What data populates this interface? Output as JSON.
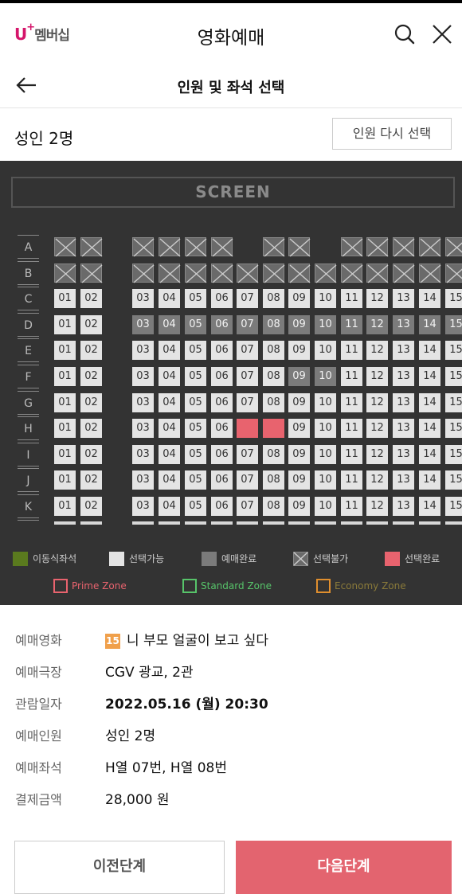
{
  "header": {
    "logo_u": "U",
    "logo_plus": "+",
    "logo_text": "멤버십",
    "title": "영화예매",
    "search_icon": "search-icon",
    "close_icon": "close-icon"
  },
  "subheader": {
    "back_icon": "arrow-left-icon",
    "title": "인원 및 좌석 선택"
  },
  "people": {
    "label": "성인 2명",
    "reselect_label": "인원 다시 선택"
  },
  "seatmap": {
    "screen_label": "SCREEN",
    "rows": [
      {
        "label": "A",
        "seats": [
          "x",
          "x",
          "_",
          "x",
          "x",
          "x",
          "x",
          "_",
          "x",
          "x",
          "_",
          "x",
          "x",
          "x",
          "x",
          "x"
        ]
      },
      {
        "label": "B",
        "seats": [
          "x",
          "x",
          "_",
          "x",
          "x",
          "x",
          "x",
          "x",
          "x",
          "x",
          "x",
          "x",
          "x",
          "x",
          "x",
          "x"
        ]
      },
      {
        "label": "C",
        "seats": [
          "01",
          "02",
          "_",
          "03",
          "04",
          "05",
          "06",
          "07",
          "08",
          "09",
          "10",
          "11",
          "12",
          "13",
          "14",
          "15"
        ]
      },
      {
        "label": "D",
        "seats": [
          "01",
          "02",
          "_",
          "03",
          "04",
          "05",
          "06",
          "07",
          "08",
          "09",
          "10",
          "11",
          "12",
          "13",
          "14",
          "15"
        ],
        "done": [
          "03",
          "04",
          "05",
          "06",
          "07",
          "08",
          "09",
          "10",
          "11",
          "12",
          "13",
          "14",
          "15"
        ]
      },
      {
        "label": "E",
        "seats": [
          "01",
          "02",
          "_",
          "03",
          "04",
          "05",
          "06",
          "07",
          "08",
          "09",
          "10",
          "11",
          "12",
          "13",
          "14",
          "15"
        ]
      },
      {
        "label": "F",
        "seats": [
          "01",
          "02",
          "_",
          "03",
          "04",
          "05",
          "06",
          "07",
          "08",
          "09",
          "10",
          "11",
          "12",
          "13",
          "14",
          "15"
        ],
        "done": [
          "09",
          "10"
        ]
      },
      {
        "label": "G",
        "seats": [
          "01",
          "02",
          "_",
          "03",
          "04",
          "05",
          "06",
          "07",
          "08",
          "09",
          "10",
          "11",
          "12",
          "13",
          "14",
          "15"
        ]
      },
      {
        "label": "H",
        "seats": [
          "01",
          "02",
          "_",
          "03",
          "04",
          "05",
          "06",
          "07",
          "08",
          "09",
          "10",
          "11",
          "12",
          "13",
          "14",
          "15"
        ],
        "selected": [
          "07",
          "08"
        ]
      },
      {
        "label": "I",
        "seats": [
          "01",
          "02",
          "_",
          "03",
          "04",
          "05",
          "06",
          "07",
          "08",
          "09",
          "10",
          "11",
          "12",
          "13",
          "14",
          "15"
        ]
      },
      {
        "label": "J",
        "seats": [
          "01",
          "02",
          "_",
          "03",
          "04",
          "05",
          "06",
          "07",
          "08",
          "09",
          "10",
          "11",
          "12",
          "13",
          "14",
          "15"
        ]
      },
      {
        "label": "K",
        "seats": [
          "01",
          "02",
          "_",
          "03",
          "04",
          "05",
          "06",
          "07",
          "08",
          "09",
          "10",
          "11",
          "12",
          "13",
          "14",
          "15"
        ]
      }
    ],
    "legend": [
      {
        "key": "wheelchair",
        "label": "이동식좌석",
        "color": "#5a7a1e"
      },
      {
        "key": "available",
        "label": "선택가능",
        "color": "#e4e4e4"
      },
      {
        "key": "reserved",
        "label": "예매완료",
        "color": "#7b7b7b"
      },
      {
        "key": "unavailable",
        "label": "선택불가",
        "color": "#6a6a6a"
      },
      {
        "key": "selected",
        "label": "선택완료",
        "color": "#e8636e"
      }
    ],
    "zones": [
      {
        "label": "Prime Zone",
        "color": "#e8636e"
      },
      {
        "label": "Standard Zone",
        "color": "#57c46a"
      },
      {
        "label": "Economy Zone",
        "color": "#e08f2e"
      }
    ]
  },
  "details": {
    "movie_label": "예매영화",
    "movie_rating": "15",
    "movie_value": "니 부모 얼굴이 보고 싶다",
    "theater_label": "예매극장",
    "theater_value": "CGV 광교, 2관",
    "date_label": "관람일자",
    "date_value": "2022.05.16 (월) 20:30",
    "count_label": "예매인원",
    "count_value": "성인 2명",
    "seats_label": "예매좌석",
    "seats_value": "H열 07번, H열 08번",
    "price_label": "결제금액",
    "price_value": "28,000 원"
  },
  "buttons": {
    "prev_label": "이전단계",
    "next_label": "다음단계"
  }
}
